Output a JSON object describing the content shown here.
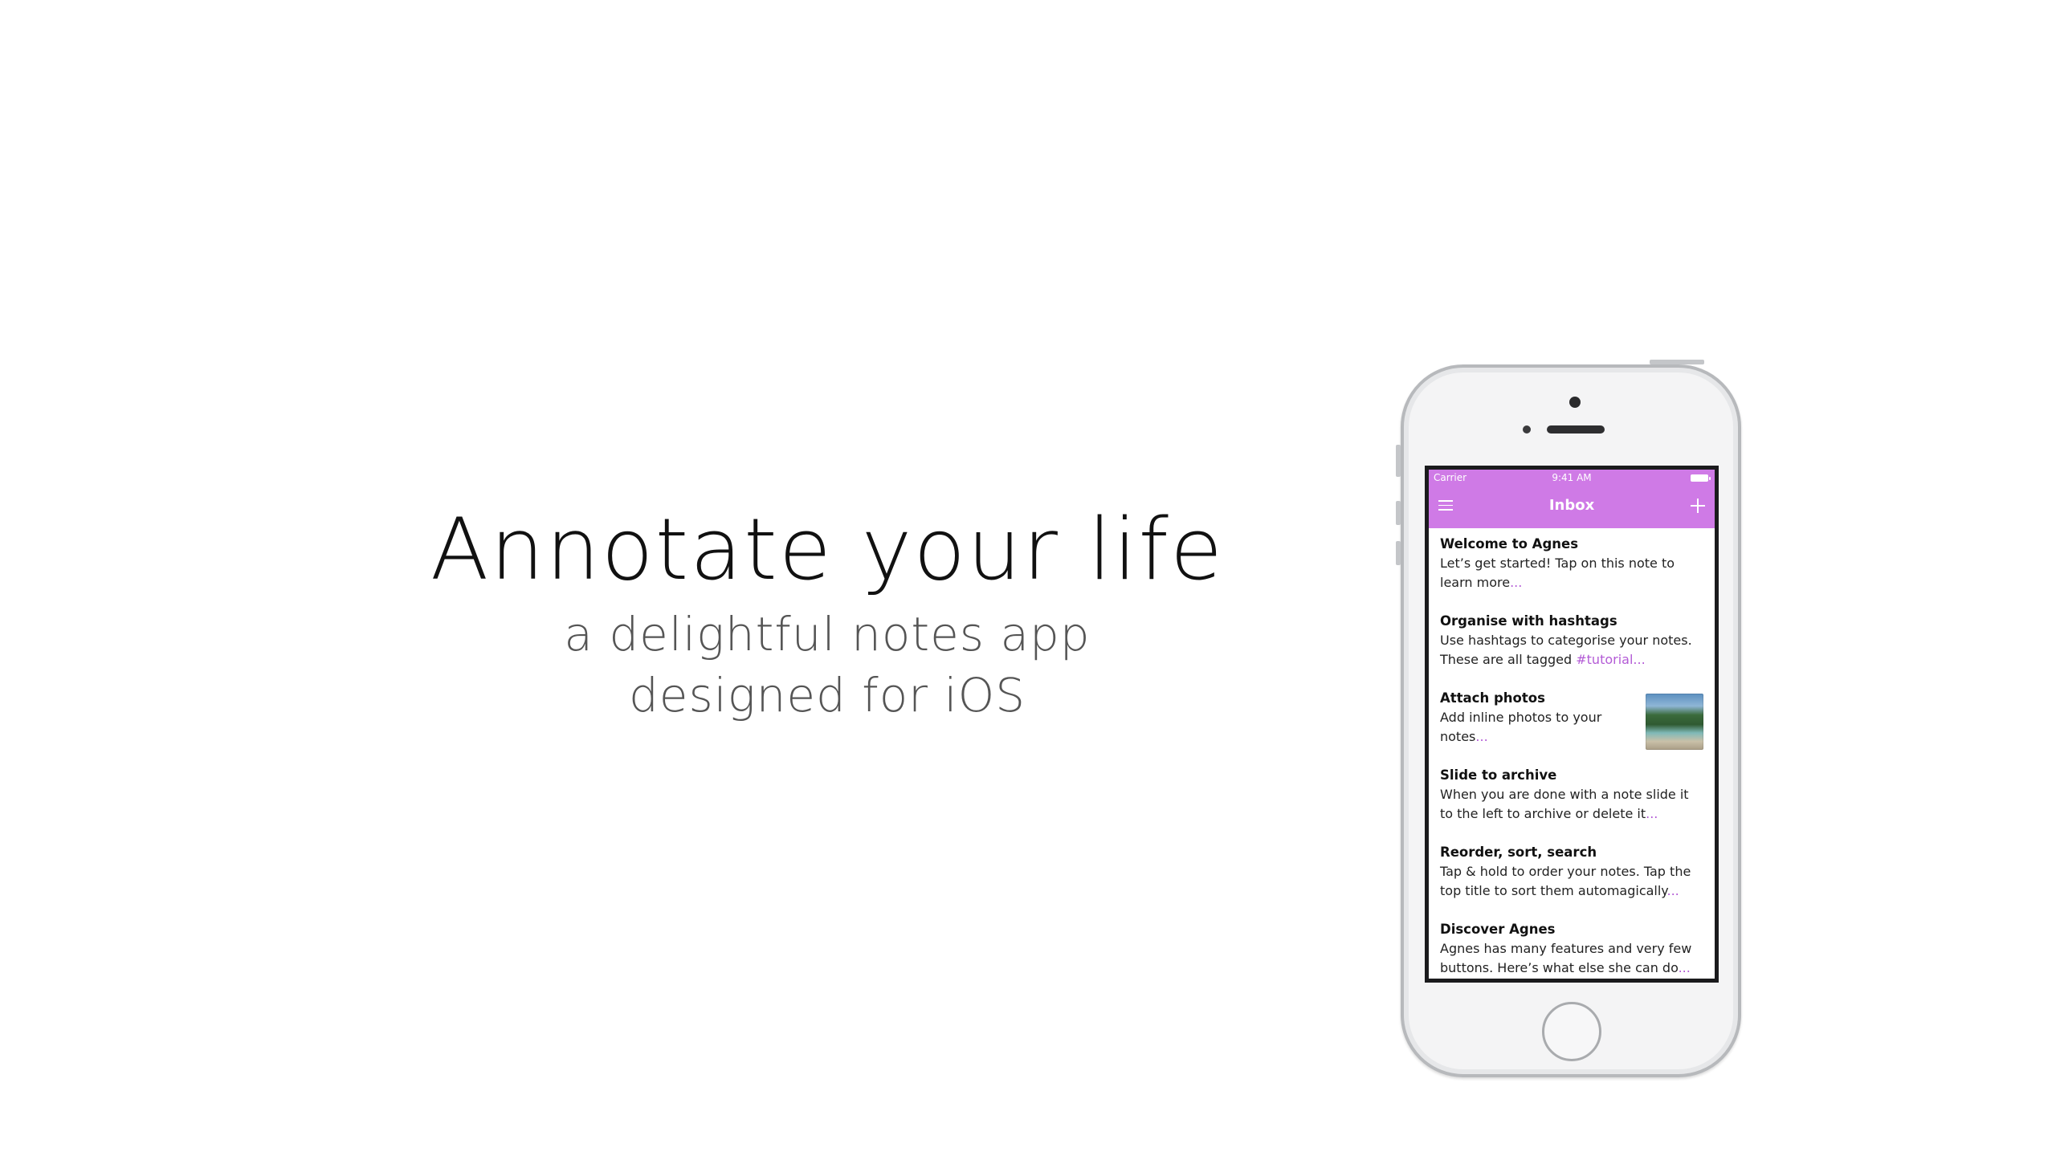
{
  "hero": {
    "title": "Annotate your life",
    "subtitle_line1": "a delightful notes app",
    "subtitle_line2": "designed for iOS"
  },
  "phone": {
    "status": {
      "carrier": "Carrier",
      "time": "9:41 AM"
    },
    "nav": {
      "title": "Inbox",
      "menu_icon": "hamburger-menu-icon",
      "add_icon": "plus-icon"
    },
    "accent_color": "#cf7ae6",
    "notes": [
      {
        "title": "Welcome to Agnes",
        "body": "Let’s get started! Tap on this note to learn more",
        "ellipsis": "..."
      },
      {
        "title": "Organise with hashtags",
        "body": "Use hashtags to categorise your notes. These are all tagged ",
        "tag": "#tutorial",
        "ellipsis": "..."
      },
      {
        "title": "Attach photos",
        "body": "Add inline photos to your notes",
        "ellipsis": "...",
        "photo": "beach-photo"
      },
      {
        "title": "Slide to archive",
        "body": "When you are done with a note slide it to the left to archive or delete it",
        "ellipsis": "..."
      },
      {
        "title": "Reorder, sort, search",
        "body": "Tap & hold to order your notes. Tap the top title to sort them automagically",
        "ellipsis": "..."
      },
      {
        "title": "Discover Agnes",
        "body": "Agnes has many features and very few buttons. Here’s what else she can do",
        "ellipsis": "..."
      }
    ]
  }
}
